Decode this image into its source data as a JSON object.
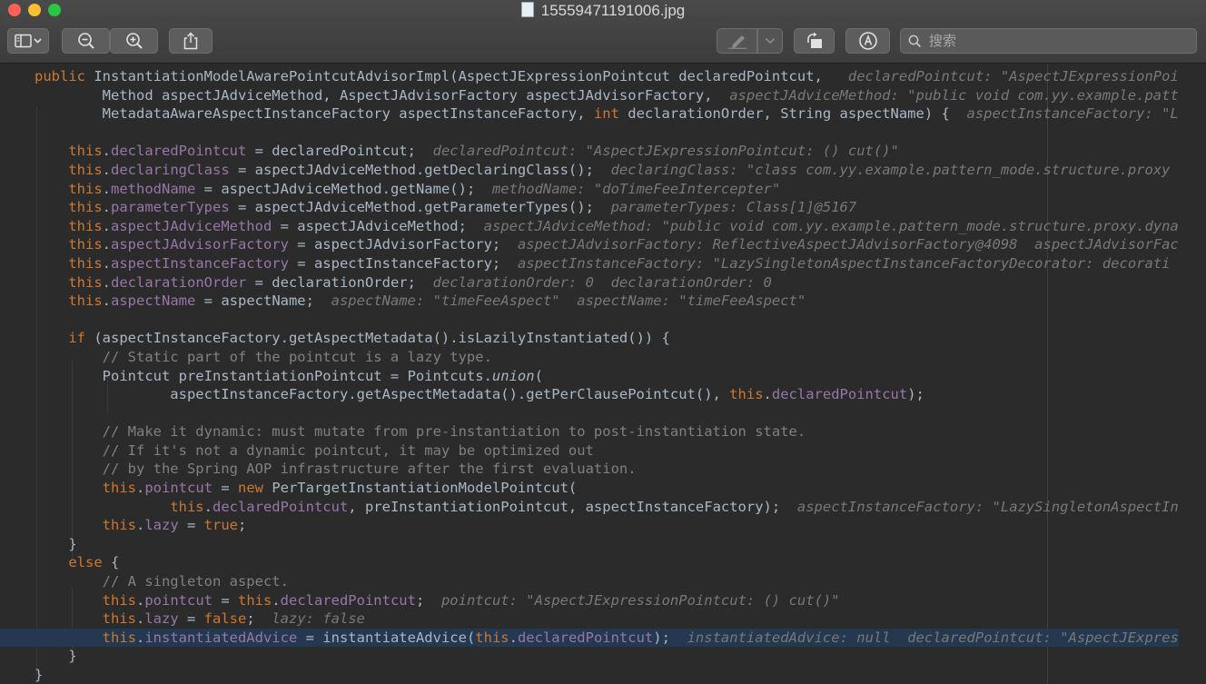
{
  "window": {
    "title": "15559471191006.jpg"
  },
  "toolbar": {
    "search_placeholder": "搜索"
  },
  "code": {
    "lines": [
      [
        [
          "kw",
          "public "
        ],
        [
          "fn",
          "InstantiationModelAwarePointcutAdvisorImpl"
        ],
        [
          "t",
          "(AspectJExpressionPointcut declaredPointcut, "
        ],
        [
          "h",
          "  declaredPointcut: \"AspectJExpressionPoi"
        ]
      ],
      [
        [
          "t",
          "        Method aspectJAdviceMethod, AspectJAdvisorFactory aspectJAdvisorFactory, "
        ],
        [
          "h",
          " aspectJAdviceMethod: \"public void com.yy.example.patt"
        ]
      ],
      [
        [
          "t",
          "        MetadataAwareAspectInstanceFactory aspectInstanceFactory, "
        ],
        [
          "kw",
          "int "
        ],
        [
          "t",
          "declarationOrder, String aspectName) { "
        ],
        [
          "h",
          " aspectInstanceFactory: \"L"
        ]
      ],
      [
        [
          "t",
          ""
        ]
      ],
      [
        [
          "t",
          "    "
        ],
        [
          "kw",
          "this"
        ],
        [
          "t",
          "."
        ],
        [
          "fl",
          "declaredPointcut"
        ],
        [
          "t",
          " = declaredPointcut; "
        ],
        [
          "h",
          " declaredPointcut: \"AspectJExpressionPointcut: () cut()\""
        ]
      ],
      [
        [
          "t",
          "    "
        ],
        [
          "kw",
          "this"
        ],
        [
          "t",
          "."
        ],
        [
          "fl",
          "declaringClass"
        ],
        [
          "t",
          " = aspectJAdviceMethod.getDeclaringClass(); "
        ],
        [
          "h",
          " declaringClass: \"class com.yy.example.pattern_mode.structure.proxy"
        ]
      ],
      [
        [
          "t",
          "    "
        ],
        [
          "kw",
          "this"
        ],
        [
          "t",
          "."
        ],
        [
          "fl",
          "methodName"
        ],
        [
          "t",
          " = aspectJAdviceMethod.getName(); "
        ],
        [
          "h",
          " methodName: \"doTimeFeeIntercepter\""
        ]
      ],
      [
        [
          "t",
          "    "
        ],
        [
          "kw",
          "this"
        ],
        [
          "t",
          "."
        ],
        [
          "fl",
          "parameterTypes"
        ],
        [
          "t",
          " = aspectJAdviceMethod.getParameterTypes(); "
        ],
        [
          "h",
          " parameterTypes: Class[1]@5167"
        ]
      ],
      [
        [
          "t",
          "    "
        ],
        [
          "kw",
          "this"
        ],
        [
          "t",
          "."
        ],
        [
          "fl",
          "aspectJAdviceMethod"
        ],
        [
          "t",
          " = aspectJAdviceMethod; "
        ],
        [
          "h",
          " aspectJAdviceMethod: \"public void com.yy.example.pattern_mode.structure.proxy.dyna"
        ]
      ],
      [
        [
          "t",
          "    "
        ],
        [
          "kw",
          "this"
        ],
        [
          "t",
          "."
        ],
        [
          "fl",
          "aspectJAdvisorFactory"
        ],
        [
          "t",
          " = aspectJAdvisorFactory; "
        ],
        [
          "h",
          " aspectJAdvisorFactory: ReflectiveAspectJAdvisorFactory@4098  aspectJAdvisorFac"
        ]
      ],
      [
        [
          "t",
          "    "
        ],
        [
          "kw",
          "this"
        ],
        [
          "t",
          "."
        ],
        [
          "fl",
          "aspectInstanceFactory"
        ],
        [
          "t",
          " = aspectInstanceFactory; "
        ],
        [
          "h",
          " aspectInstanceFactory: \"LazySingletonAspectInstanceFactoryDecorator: decorati"
        ]
      ],
      [
        [
          "t",
          "    "
        ],
        [
          "kw",
          "this"
        ],
        [
          "t",
          "."
        ],
        [
          "fl",
          "declarationOrder"
        ],
        [
          "t",
          " = declarationOrder; "
        ],
        [
          "h",
          " declarationOrder: 0  declarationOrder: 0"
        ]
      ],
      [
        [
          "t",
          "    "
        ],
        [
          "kw",
          "this"
        ],
        [
          "t",
          "."
        ],
        [
          "fl",
          "aspectName"
        ],
        [
          "t",
          " = aspectName; "
        ],
        [
          "h",
          " aspectName: \"timeFeeAspect\"  aspectName: \"timeFeeAspect\""
        ]
      ],
      [
        [
          "t",
          ""
        ]
      ],
      [
        [
          "t",
          "    "
        ],
        [
          "kw",
          "if "
        ],
        [
          "t",
          "(aspectInstanceFactory.getAspectMetadata().isLazilyInstantiated()) {"
        ]
      ],
      [
        [
          "t",
          "        "
        ],
        [
          "c",
          "// Static part of the pointcut is a lazy type."
        ]
      ],
      [
        [
          "t",
          "        Pointcut preInstantiationPointcut = Pointcuts."
        ],
        [
          "i",
          "union"
        ],
        [
          "t",
          "("
        ]
      ],
      [
        [
          "t",
          "                aspectInstanceFactory.getAspectMetadata().getPerClausePointcut(), "
        ],
        [
          "kw",
          "this"
        ],
        [
          "t",
          "."
        ],
        [
          "fl",
          "declaredPointcut"
        ],
        [
          "t",
          ");"
        ]
      ],
      [
        [
          "t",
          ""
        ]
      ],
      [
        [
          "t",
          "        "
        ],
        [
          "c",
          "// Make it dynamic: must mutate from pre-instantiation to post-instantiation state."
        ]
      ],
      [
        [
          "t",
          "        "
        ],
        [
          "c",
          "// If it's not a dynamic pointcut, it may be optimized out"
        ]
      ],
      [
        [
          "t",
          "        "
        ],
        [
          "c",
          "// by the Spring AOP infrastructure after the first evaluation."
        ]
      ],
      [
        [
          "t",
          "        "
        ],
        [
          "kw",
          "this"
        ],
        [
          "t",
          "."
        ],
        [
          "fl",
          "pointcut"
        ],
        [
          "t",
          " = "
        ],
        [
          "kw",
          "new "
        ],
        [
          "t",
          "PerTargetInstantiationModelPointcut("
        ]
      ],
      [
        [
          "t",
          "                "
        ],
        [
          "kw",
          "this"
        ],
        [
          "t",
          "."
        ],
        [
          "fl",
          "declaredPointcut"
        ],
        [
          "t",
          ", preInstantiationPointcut, aspectInstanceFactory); "
        ],
        [
          "h",
          " aspectInstanceFactory: \"LazySingletonAspectIn"
        ]
      ],
      [
        [
          "t",
          "        "
        ],
        [
          "kw",
          "this"
        ],
        [
          "t",
          "."
        ],
        [
          "fl",
          "lazy"
        ],
        [
          "t",
          " = "
        ],
        [
          "kw",
          "true"
        ],
        [
          "t",
          ";"
        ]
      ],
      [
        [
          "t",
          "    }"
        ]
      ],
      [
        [
          "t",
          "    "
        ],
        [
          "kw",
          "else "
        ],
        [
          "t",
          "{"
        ]
      ],
      [
        [
          "t",
          "        "
        ],
        [
          "c",
          "// A singleton aspect."
        ]
      ],
      [
        [
          "t",
          "        "
        ],
        [
          "kw",
          "this"
        ],
        [
          "t",
          "."
        ],
        [
          "fl",
          "pointcut"
        ],
        [
          "t",
          " = "
        ],
        [
          "kw",
          "this"
        ],
        [
          "t",
          "."
        ],
        [
          "fl",
          "declaredPointcut"
        ],
        [
          "t",
          "; "
        ],
        [
          "h",
          " pointcut: \"AspectJExpressionPointcut: () cut()\""
        ]
      ],
      [
        [
          "t",
          "        "
        ],
        [
          "kw",
          "this"
        ],
        [
          "t",
          "."
        ],
        [
          "fl",
          "lazy"
        ],
        [
          "t",
          " = "
        ],
        [
          "kw",
          "false"
        ],
        [
          "t",
          "; "
        ],
        [
          "h",
          " lazy: false"
        ]
      ],
      [
        [
          "t",
          "        "
        ],
        [
          "kw",
          "this"
        ],
        [
          "t",
          "."
        ],
        [
          "fl",
          "instantiatedAdvice"
        ],
        [
          "t",
          " = instantiateAdvice("
        ],
        [
          "kw",
          "this"
        ],
        [
          "t",
          "."
        ],
        [
          "fl",
          "declaredPointcut"
        ],
        [
          "t",
          "); "
        ],
        [
          "h",
          " instantiatedAdvice: null  declaredPointcut: \"AspectJExpres"
        ]
      ],
      [
        [
          "t",
          "    }"
        ]
      ],
      [
        [
          "t",
          "}"
        ]
      ]
    ],
    "highlighted_line": 30
  }
}
